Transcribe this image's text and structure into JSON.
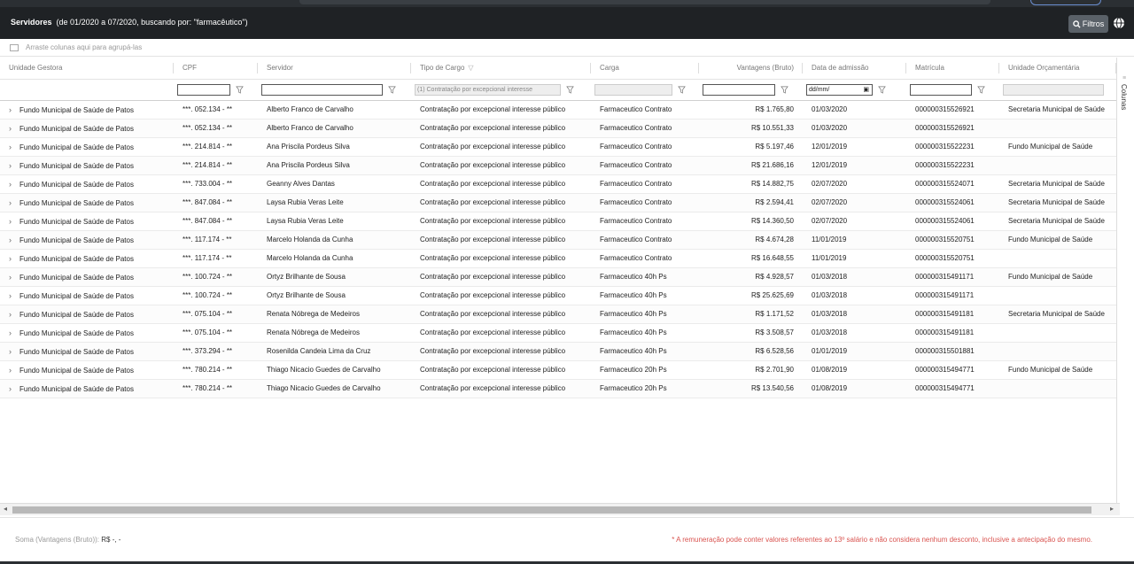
{
  "header": {
    "title_bold": "Servidores",
    "title_rest": "(de 01/2020 a 07/2020, buscando por: \"farmacêutico\")",
    "filtros_label": "Filtros"
  },
  "groupbar": {
    "hint": "Arraste colunas aqui para agrupá-las"
  },
  "columns": [
    "Unidade Gestora",
    "CPF",
    "Servidor",
    "Tipo de Cargo",
    "Carga",
    "Vantagens (Bruto)",
    "Data de admissão",
    "Matrícula",
    "Unidade Orçamentária"
  ],
  "filters": {
    "tipo_de_cargo_value": "(1) Contratação por excepcional interesse",
    "data_admissao_value": "dd/mm/"
  },
  "rows": [
    [
      "Fundo Municipal de Saúde de Patos",
      "***. 052.134 - **",
      "Alberto Franco de Carvalho",
      "Contratação por excepcional interesse público",
      "Farmaceutico Contrato",
      "R$ 1.765,80",
      "01/03/2020",
      "000000315526921",
      "Secretaria Municipal de Saúde"
    ],
    [
      "Fundo Municipal de Saúde de Patos",
      "***. 052.134 - **",
      "Alberto Franco de Carvalho",
      "Contratação por excepcional interesse público",
      "Farmaceutico Contrato",
      "R$ 10.551,33",
      "01/03/2020",
      "000000315526921",
      ""
    ],
    [
      "Fundo Municipal de Saúde de Patos",
      "***. 214.814 - **",
      "Ana Priscila Pordeus Silva",
      "Contratação por excepcional interesse público",
      "Farmaceutico Contrato",
      "R$ 5.197,46",
      "12/01/2019",
      "000000315522231",
      "Fundo Municipal de Saúde"
    ],
    [
      "Fundo Municipal de Saúde de Patos",
      "***. 214.814 - **",
      "Ana Priscila Pordeus Silva",
      "Contratação por excepcional interesse público",
      "Farmaceutico Contrato",
      "R$ 21.686,16",
      "12/01/2019",
      "000000315522231",
      ""
    ],
    [
      "Fundo Municipal de Saúde de Patos",
      "***. 733.004 - **",
      "Geanny Alves Dantas",
      "Contratação por excepcional interesse público",
      "Farmaceutico Contrato",
      "R$ 14.882,75",
      "02/07/2020",
      "000000315524071",
      "Secretaria Municipal de Saúde"
    ],
    [
      "Fundo Municipal de Saúde de Patos",
      "***. 847.084 - **",
      "Laysa Rubia Veras Leite",
      "Contratação por excepcional interesse público",
      "Farmaceutico Contrato",
      "R$ 2.594,41",
      "02/07/2020",
      "000000315524061",
      "Secretaria Municipal de Saúde"
    ],
    [
      "Fundo Municipal de Saúde de Patos",
      "***. 847.084 - **",
      "Laysa Rubia Veras Leite",
      "Contratação por excepcional interesse público",
      "Farmaceutico Contrato",
      "R$ 14.360,50",
      "02/07/2020",
      "000000315524061",
      "Secretaria Municipal de Saúde"
    ],
    [
      "Fundo Municipal de Saúde de Patos",
      "***. 117.174 - **",
      "Marcelo Holanda da Cunha",
      "Contratação por excepcional interesse público",
      "Farmaceutico Contrato",
      "R$ 4.674,28",
      "11/01/2019",
      "000000315520751",
      "Fundo Municipal de Saúde"
    ],
    [
      "Fundo Municipal de Saúde de Patos",
      "***. 117.174 - **",
      "Marcelo Holanda da Cunha",
      "Contratação por excepcional interesse público",
      "Farmaceutico Contrato",
      "R$ 16.648,55",
      "11/01/2019",
      "000000315520751",
      ""
    ],
    [
      "Fundo Municipal de Saúde de Patos",
      "***. 100.724 - **",
      "Ortyz Brilhante de Sousa",
      "Contratação por excepcional interesse público",
      "Farmaceutico 40h Ps",
      "R$ 4.928,57",
      "01/03/2018",
      "000000315491171",
      "Fundo Municipal de Saúde"
    ],
    [
      "Fundo Municipal de Saúde de Patos",
      "***. 100.724 - **",
      "Ortyz Brilhante de Sousa",
      "Contratação por excepcional interesse público",
      "Farmaceutico 40h Ps",
      "R$ 25.625,69",
      "01/03/2018",
      "000000315491171",
      ""
    ],
    [
      "Fundo Municipal de Saúde de Patos",
      "***. 075.104 - **",
      "Renata Nóbrega de Medeiros",
      "Contratação por excepcional interesse público",
      "Farmaceutico 40h Ps",
      "R$ 1.171,52",
      "01/03/2018",
      "000000315491181",
      "Secretaria Municipal de Saúde"
    ],
    [
      "Fundo Municipal de Saúde de Patos",
      "***. 075.104 - **",
      "Renata Nóbrega de Medeiros",
      "Contratação por excepcional interesse público",
      "Farmaceutico 40h Ps",
      "R$ 3.508,57",
      "01/03/2018",
      "000000315491181",
      ""
    ],
    [
      "Fundo Municipal de Saúde de Patos",
      "***. 373.294 - **",
      "Rosenilda Candeia Lima da Cruz",
      "Contratação por excepcional interesse público",
      "Farmaceutico 40h Ps",
      "R$ 6.528,56",
      "01/01/2019",
      "000000315501881",
      ""
    ],
    [
      "Fundo Municipal de Saúde de Patos",
      "***. 780.214 - **",
      "Thiago Nicacio Guedes de Carvalho",
      "Contratação por excepcional interesse público",
      "Farmaceutico 20h Ps",
      "R$ 2.701,90",
      "01/08/2019",
      "000000315494771",
      "Fundo Municipal de Saúde"
    ],
    [
      "Fundo Municipal de Saúde de Patos",
      "***. 780.214 - **",
      "Thiago Nicacio Guedes de Carvalho",
      "Contratação por excepcional interesse público",
      "Farmaceutico 20h Ps",
      "R$ 13.540,56",
      "01/08/2019",
      "000000315494771",
      ""
    ]
  ],
  "sidebar": {
    "label": "Colunas"
  },
  "footer": {
    "soma_label": "Soma (Vantagens (Bruto)):",
    "soma_value": "R$ -, -",
    "note": "* A remuneração pode conter valores referentes ao 13º salário e não considera nenhum desconto, inclusive a antecipação do mesmo."
  },
  "colors": {
    "header_bg": "#1f2225",
    "note_red": "#d9534f"
  },
  "icons": [
    "search-icon",
    "globe-icon",
    "funnel-icon",
    "chevron-right-icon",
    "group-icon",
    "calendar-icon"
  ]
}
